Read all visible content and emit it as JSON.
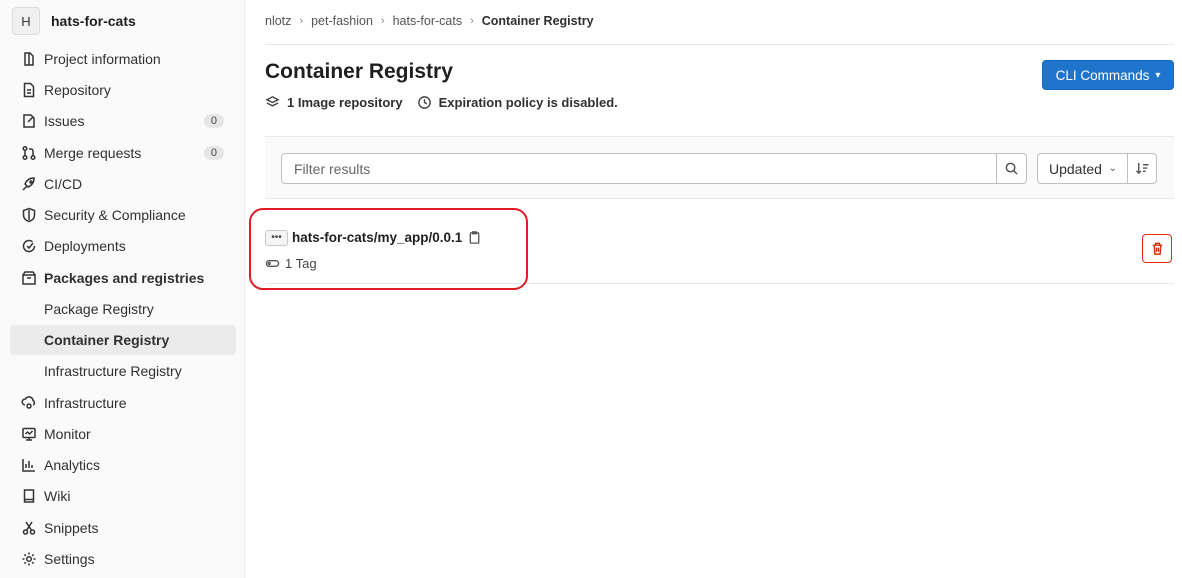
{
  "project": {
    "avatar_letter": "H",
    "name": "hats-for-cats"
  },
  "sidebar": {
    "items": [
      {
        "label": "Project information",
        "icon": "project-info-icon"
      },
      {
        "label": "Repository",
        "icon": "doc-icon"
      },
      {
        "label": "Issues",
        "icon": "issues-icon",
        "badge": "0"
      },
      {
        "label": "Merge requests",
        "icon": "merge-request-icon",
        "badge": "0"
      },
      {
        "label": "CI/CD",
        "icon": "rocket-icon"
      },
      {
        "label": "Security & Compliance",
        "icon": "shield-icon"
      },
      {
        "label": "Deployments",
        "icon": "deployments-icon"
      },
      {
        "label": "Packages and registries",
        "icon": "package-icon"
      },
      {
        "label": "Package Registry"
      },
      {
        "label": "Container Registry"
      },
      {
        "label": "Infrastructure Registry"
      },
      {
        "label": "Infrastructure",
        "icon": "cloud-gear-icon"
      },
      {
        "label": "Monitor",
        "icon": "monitor-icon"
      },
      {
        "label": "Analytics",
        "icon": "chart-icon"
      },
      {
        "label": "Wiki",
        "icon": "book-icon"
      },
      {
        "label": "Snippets",
        "icon": "scissors-icon"
      },
      {
        "label": "Settings",
        "icon": "gear-icon"
      }
    ]
  },
  "breadcrumb": [
    "nlotz",
    "pet-fashion",
    "hats-for-cats",
    "Container Registry"
  ],
  "header": {
    "title": "Container Registry",
    "cli_button": "CLI Commands"
  },
  "meta": {
    "repo_count": "1 Image repository",
    "expiration": "Expiration policy is disabled."
  },
  "filter": {
    "placeholder": "Filter results",
    "sort_label": "Updated"
  },
  "repo": {
    "name": "hats-for-cats/my_app/0.0.1",
    "tags": "1 Tag"
  },
  "colors": {
    "primary": "#1f75cb",
    "danger": "#dd2b0e",
    "highlight": "#e01b24"
  }
}
